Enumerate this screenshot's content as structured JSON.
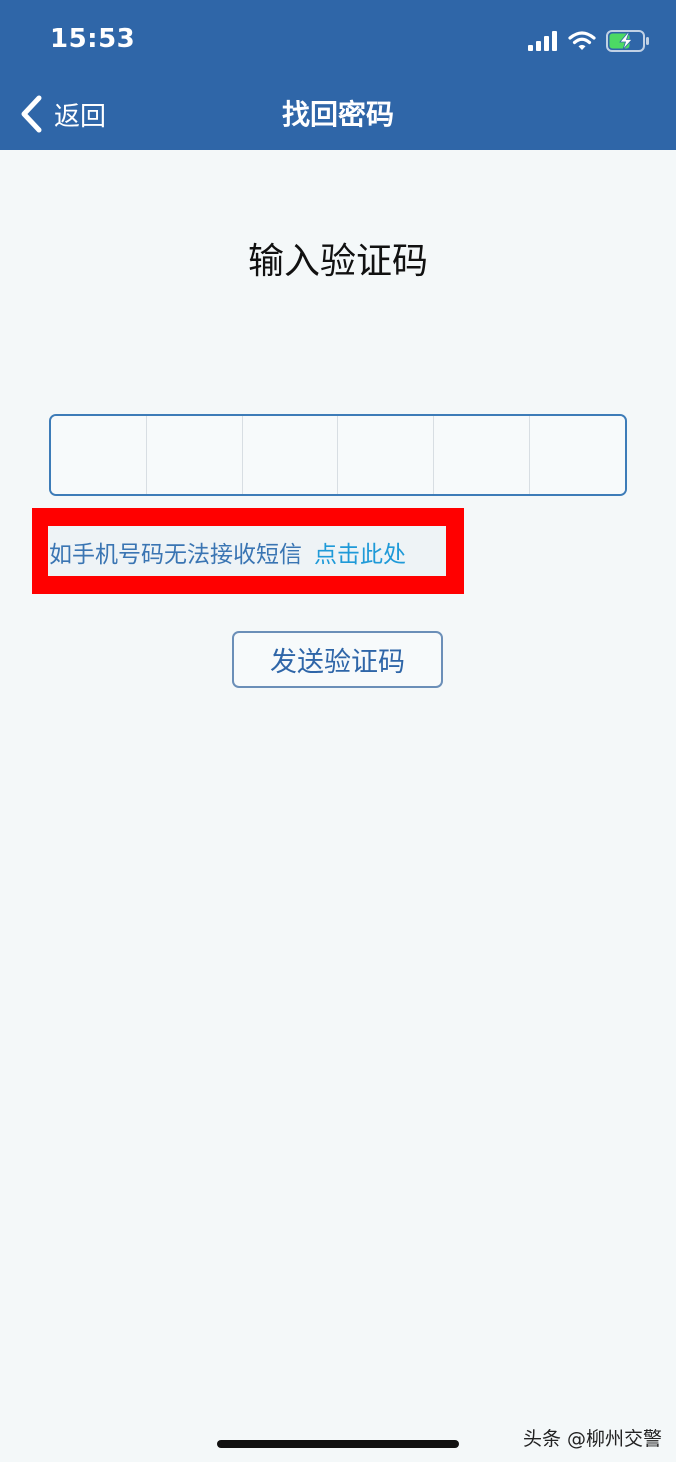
{
  "status_bar": {
    "time": "15:53",
    "icons": [
      "cellular-signal-icon",
      "wifi-icon",
      "battery-charging-icon"
    ]
  },
  "nav": {
    "back_label": "返回",
    "title": "找回密码"
  },
  "main": {
    "heading": "输入验证码",
    "code_cells": [
      "",
      "",
      "",
      "",
      "",
      ""
    ],
    "help_text": "如手机号码无法接收短信",
    "help_link": "点击此处",
    "send_button_label": "发送验证码"
  },
  "watermark": "头条 @柳州交警",
  "colors": {
    "header": "#2f66a8",
    "accent_border": "#3d7cb8",
    "link": "#1f9ad8",
    "highlight": "#ff0000",
    "background": "#f4f8f9"
  }
}
